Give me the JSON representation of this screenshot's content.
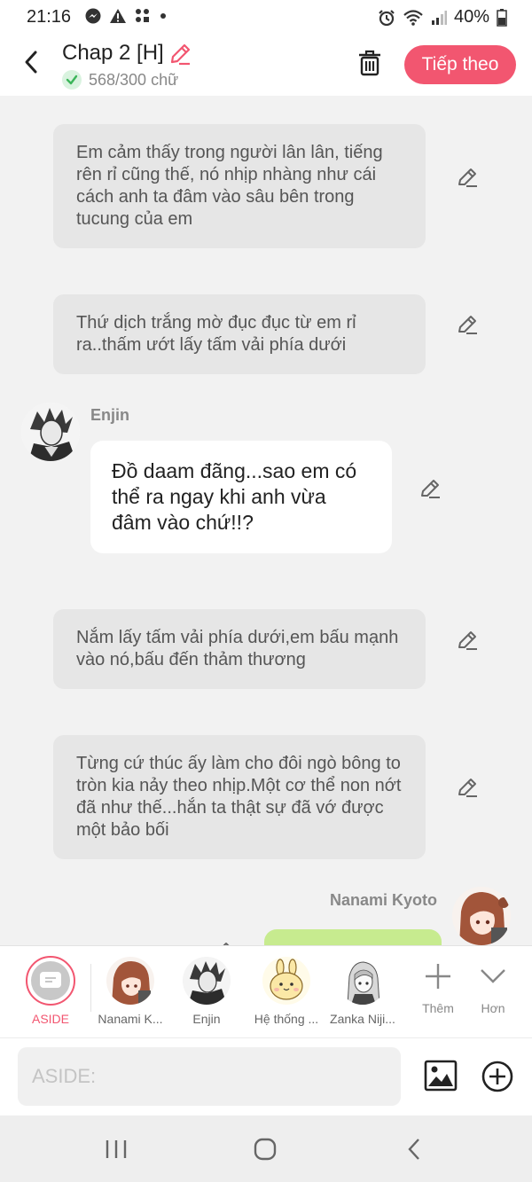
{
  "status_bar": {
    "time": "21:16",
    "battery_percent": "40%",
    "icons": [
      "messenger-icon",
      "alert-icon",
      "apps-icon",
      "dot-icon",
      "alarm-icon",
      "wifi-icon",
      "signal-icon",
      "battery-icon"
    ]
  },
  "header": {
    "title": "Chap 2 [H]",
    "word_count": "568/300 chữ",
    "next_button": "Tiếp theo",
    "accent_color": "#f25670"
  },
  "messages": [
    {
      "type": "narration",
      "text": "Em cảm thấy trong người lân lân, tiếng rên rỉ cũng thế, nó nhịp nhàng như cái cách anh ta đâm vào sâu bên trong tucung của em"
    },
    {
      "type": "narration",
      "text": "Thứ dịch trắng mờ đục đục từ em rỉ ra..thấm ướt lấy tấm vải phía dưới"
    },
    {
      "type": "character",
      "speaker": "Enjin",
      "text": "Đồ daam đãng...sao em có thể ra ngay khi anh vừa đâm vào chứ!!?"
    },
    {
      "type": "narration",
      "text": "Nắm lấy tấm vải phía dưới,em bấu mạnh vào nó,bấu đến thảm thương"
    },
    {
      "type": "narration",
      "text": "Từng cứ thúc ấy làm cho đôi ngò bông to tròn kia nảy theo nhịp.Một cơ thể non nớt đã như thế...hắn ta thật sự đã vớ được một bảo bối"
    },
    {
      "type": "character_right",
      "speaker": "Nanami Kyoto",
      "text": ""
    }
  ],
  "character_bar": {
    "aside_label": "ASIDE",
    "characters": [
      {
        "label": "Nanami K..."
      },
      {
        "label": "Enjin"
      },
      {
        "label": "Hệ thống ..."
      },
      {
        "label": "Zanka Niji..."
      }
    ],
    "add_label": "Thêm",
    "more_label": "Hơn"
  },
  "input": {
    "placeholder": "ASIDE:",
    "value": ""
  }
}
